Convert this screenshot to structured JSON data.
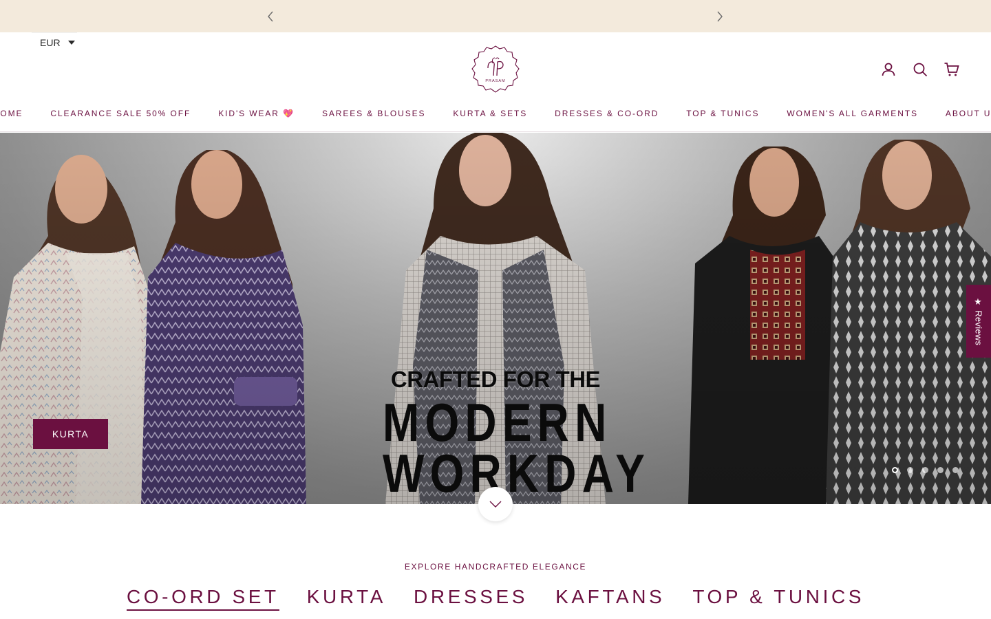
{
  "announcement": {
    "prev_icon": "chevron-left-icon",
    "next_icon": "chevron-right-icon"
  },
  "header": {
    "currency": "EUR",
    "logo_text": "PRASAM",
    "icons": [
      "account-icon",
      "search-icon",
      "cart-icon"
    ]
  },
  "nav": {
    "items": [
      {
        "label": "HOME"
      },
      {
        "label": "CLEARANCE SALE 50% OFF"
      },
      {
        "label": "KID'S WEAR 💖"
      },
      {
        "label": "SAREES & BLOUSES"
      },
      {
        "label": "KURTA & SETS"
      },
      {
        "label": "DRESSES & CO-ORD"
      },
      {
        "label": "TOP & TUNICS"
      },
      {
        "label": "WOMEN'S ALL GARMENTS"
      },
      {
        "label": "ABOUT US"
      }
    ]
  },
  "hero": {
    "headline_line1": "CRAFTED FOR THE",
    "headline_line2": "MODERN",
    "headline_line3": "WORKDAY",
    "cta_label": "KURTA",
    "slides_total": 5,
    "active_slide": 1
  },
  "reviews_tab": {
    "label": "★ Reviews"
  },
  "collection": {
    "kicker": "EXPLORE HANDCRAFTED ELEGANCE",
    "tabs": [
      {
        "label": "CO-ORD SET",
        "active": true
      },
      {
        "label": "KURTA",
        "active": false
      },
      {
        "label": "DRESSES",
        "active": false
      },
      {
        "label": "KAFTANS",
        "active": false
      },
      {
        "label": "TOP & TUNICS",
        "active": false
      }
    ]
  },
  "colors": {
    "brand": "#6b1040",
    "announcement_bg": "#f3eadc"
  }
}
